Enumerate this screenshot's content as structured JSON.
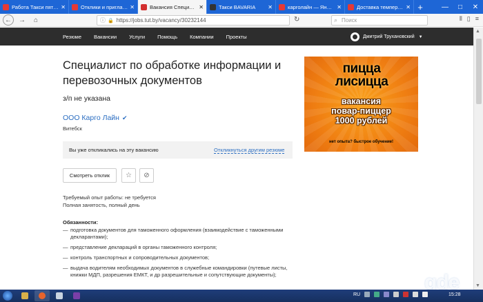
{
  "browser": {
    "tabs": [
      {
        "title": "Работа Такси пятница",
        "color": "#e53935",
        "active": false
      },
      {
        "title": "Отклики и приглашения",
        "color": "#e53935",
        "active": false
      },
      {
        "title": "Вакансия Специалист",
        "color": "#d32f2f",
        "active": true
      },
      {
        "title": "Такси BAVARIA",
        "color": "#333333",
        "active": false
      },
      {
        "title": "карголайн — Яндекс",
        "color": "#e53935",
        "active": false
      },
      {
        "title": "Доставка температур",
        "color": "#e53935",
        "active": false
      }
    ],
    "new_tab": "+",
    "url": "https://jobs.tut.by/vacancy/30232144",
    "search_placeholder": "Поиск"
  },
  "site": {
    "menu": [
      "Резюме",
      "Вакансии",
      "Услуги",
      "Помощь",
      "Компании",
      "Проекты"
    ],
    "user_name": "Дмитрий Трухановский"
  },
  "vacancy": {
    "title": "Специалист по обработке информации и перевозочных документов",
    "salary": "з/п не указана",
    "company": "ООО Карго Лайн",
    "city": "Витебск",
    "responded_text": "Вы уже откликались на эту вакансию",
    "respond_other": "Откликнуться другим резюме",
    "view_response": "Смотреть отклик",
    "experience": "Требуемый опыт работы: не требуется",
    "employment": "Полная занятость, полный день",
    "duties_title": "Обязанности:",
    "duties": [
      "подготовка документов для таможенного оформления (взаимодействие с таможенными декларантами);",
      "представление деклараций в органы таможенного контроля;",
      "контроль транспортных и сопроводительных документов;",
      "выдача водителям необходимых документов в служебные командировки (путевые листы, книжки МДП, разрешения ЕМКТ, и др разрешительные и сопутствующие документы);"
    ]
  },
  "ad": {
    "line1": "пицца",
    "line2": "лисицца",
    "line3": "вакансия",
    "line4": "повар-пиццер",
    "line5": "1000 рублей",
    "line6": "нет опыта? быстрое обучение!"
  },
  "taskbar": {
    "lang": "RU",
    "time": "15:28"
  },
  "watermark": "gde"
}
